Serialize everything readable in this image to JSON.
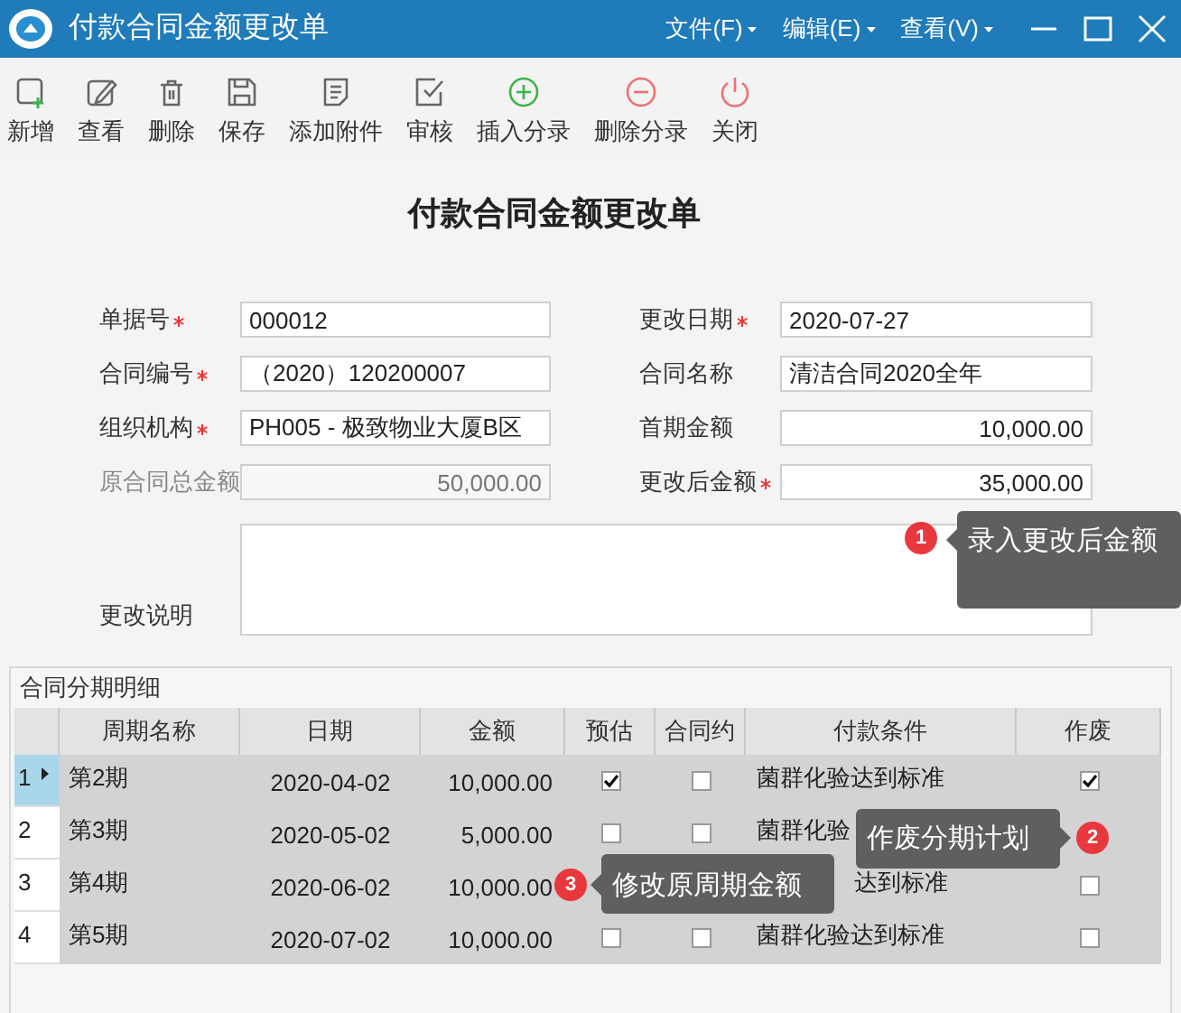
{
  "window": {
    "title": "付款合同金额更改单"
  },
  "menus": [
    {
      "label": "文件(F)"
    },
    {
      "label": "编辑(E)"
    },
    {
      "label": "查看(V)"
    }
  ],
  "toolbar": [
    {
      "label": "新增",
      "kind": "new"
    },
    {
      "label": "查看",
      "kind": "edit"
    },
    {
      "label": "删除",
      "kind": "delete"
    },
    {
      "label": "保存",
      "kind": "save"
    },
    {
      "label": "添加附件",
      "kind": "attach"
    },
    {
      "label": "审核",
      "kind": "approve"
    },
    {
      "label": "插入分录",
      "kind": "insert"
    },
    {
      "label": "删除分录",
      "kind": "remove"
    },
    {
      "label": "关闭",
      "kind": "close"
    }
  ],
  "form": {
    "heading": "付款合同金额更改单",
    "fields": [
      {
        "label": "单据号",
        "value": "000012",
        "required": true,
        "disabled": false,
        "kind": "text"
      },
      {
        "label": "更改日期",
        "value": "2020-07-27",
        "required": true,
        "disabled": false,
        "kind": "text"
      },
      {
        "label": "合同编号",
        "value": "（2020）120200007",
        "required": true,
        "disabled": false,
        "kind": "text"
      },
      {
        "label": "合同名称",
        "value": "清洁合同2020全年",
        "required": false,
        "disabled": false,
        "kind": "text"
      },
      {
        "label": "组织机构",
        "value": "PH005 - 极致物业大厦B区",
        "required": true,
        "disabled": false,
        "kind": "text"
      },
      {
        "label": "首期金额",
        "value": "10,000.00",
        "required": false,
        "disabled": false,
        "kind": "amount"
      },
      {
        "label": "原合同总金额",
        "value": "50,000.00",
        "required": false,
        "disabled": true,
        "kind": "amount"
      },
      {
        "label": "更改后金额",
        "value": "35,000.00",
        "required": true,
        "disabled": false,
        "kind": "amount"
      }
    ],
    "remarks": {
      "label": "更改说明"
    }
  },
  "grid": {
    "title": "合同分期明细",
    "columns": [
      "周期名称",
      "日期",
      "金额",
      "预估",
      "合同约",
      "付款条件",
      "作废"
    ],
    "rows": [
      {
        "number": "1",
        "selected": true,
        "name": "第2期",
        "date": "2020-04-02",
        "amount": "10,000.00",
        "estimated": true,
        "contract": false,
        "terms": "菌群化验达到标准",
        "void": true
      },
      {
        "number": "2",
        "selected": false,
        "name": "第3期",
        "date": "2020-05-02",
        "amount": "5,000.00",
        "estimated": false,
        "contract": false,
        "terms": "菌群化验"
      },
      {
        "number": "3",
        "selected": false,
        "name": "第4期",
        "date": "2020-06-02",
        "amount": "10,000.00",
        "terms": "达到标准",
        "terms_clipped": true,
        "void": false
      },
      {
        "number": "4",
        "selected": false,
        "name": "第5期",
        "date": "2020-07-02",
        "amount": "10,000.00",
        "estimated": false,
        "contract": false,
        "terms": "菌群化验达到标准",
        "void": false
      }
    ]
  },
  "callouts": [
    {
      "number": "1",
      "text": "录入更改后金额"
    },
    {
      "number": "2",
      "text": "作废分期计划"
    },
    {
      "number": "3",
      "text": "修改原周期金额"
    }
  ]
}
